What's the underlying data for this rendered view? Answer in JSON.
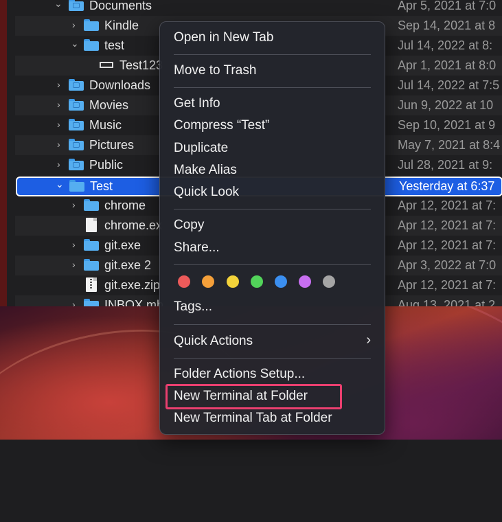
{
  "finder": {
    "rows": [
      {
        "name": "Documents",
        "date": "Apr 5, 2021 at 7:0"
      },
      {
        "name": "Kindle",
        "date": "Sep 14, 2021 at 8"
      },
      {
        "name": "test",
        "date": "Jul 14, 2022 at 8:"
      },
      {
        "name": "Test123",
        "date": "Apr 1, 2021 at 8:0"
      },
      {
        "name": "Downloads",
        "date": "Jul 14, 2022 at 7:5"
      },
      {
        "name": "Movies",
        "date": "Jun 9, 2022 at 10"
      },
      {
        "name": "Music",
        "date": "Sep 10, 2021 at 9"
      },
      {
        "name": "Pictures",
        "date": "May 7, 2021 at 8:4"
      },
      {
        "name": "Public",
        "date": "Jul 28, 2021 at 9:"
      },
      {
        "name": "Test",
        "date": "Yesterday at 6:37"
      },
      {
        "name": "chrome",
        "date": "Apr 12, 2021 at 7:"
      },
      {
        "name": "chrome.ex",
        "date": "Apr 12, 2021 at 7:"
      },
      {
        "name": "git.exe",
        "date": "Apr 12, 2021 at 7:"
      },
      {
        "name": "git.exe 2",
        "date": "Apr 3, 2022 at 7:0"
      },
      {
        "name": "git.exe.zip",
        "date": "Apr 12, 2021 at 7:"
      },
      {
        "name": "INBOX.mb",
        "date": "Aug 13, 2021 at 2"
      }
    ]
  },
  "context_menu": {
    "open_new_tab": "Open in New Tab",
    "move_to_trash": "Move to Trash",
    "get_info": "Get Info",
    "compress": "Compress “Test”",
    "duplicate": "Duplicate",
    "make_alias": "Make Alias",
    "quick_look": "Quick Look",
    "copy": "Copy",
    "share": "Share...",
    "tags": "Tags...",
    "quick_actions": "Quick Actions",
    "quick_actions_arrow": "›",
    "folder_actions_setup": "Folder Actions Setup...",
    "new_terminal": "New Terminal at Folder",
    "new_terminal_tab": "New Terminal Tab at Folder",
    "tag_colors": [
      "#ec5a5a",
      "#f5a03a",
      "#f3d33a",
      "#52d35a",
      "#3b8ff0",
      "#c76ff0",
      "#a5a5a5"
    ]
  },
  "colors": {
    "selection": "#1d5ee3",
    "highlight_box": "#ea3f6f"
  }
}
